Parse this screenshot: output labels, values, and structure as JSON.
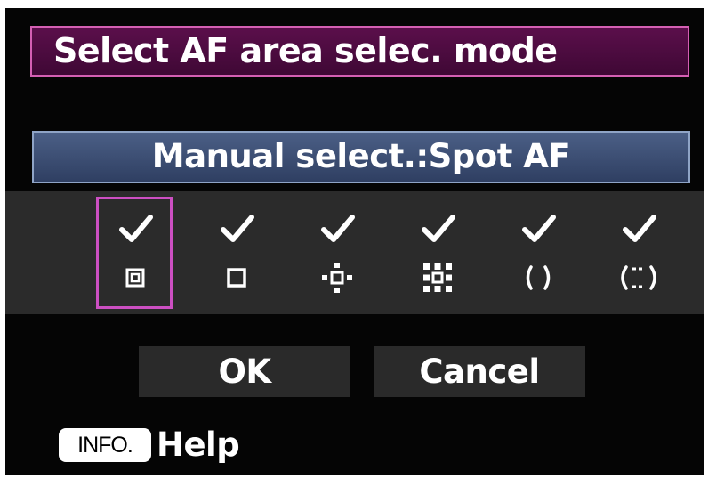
{
  "header": {
    "title": "Select AF area selec. mode"
  },
  "mode_label": "Manual select.:Spot AF",
  "af_options": [
    {
      "icon": "spot-af-icon",
      "checked": true,
      "selected": true
    },
    {
      "icon": "single-point-af-icon",
      "checked": true,
      "selected": false
    },
    {
      "icon": "af-point-expansion-icon",
      "checked": true,
      "selected": false
    },
    {
      "icon": "af-point-expansion-surround-icon",
      "checked": true,
      "selected": false
    },
    {
      "icon": "zone-af-icon",
      "checked": true,
      "selected": false
    },
    {
      "icon": "auto-af-selection-icon",
      "checked": true,
      "selected": false
    }
  ],
  "buttons": {
    "ok_label": "OK",
    "cancel_label": "Cancel"
  },
  "footer": {
    "info_key_label": "INFO.",
    "help_label": "Help"
  },
  "colors": {
    "title_bg": "#4d0c41",
    "title_border": "#d45fb3",
    "mode_bg": "#3d4e72",
    "selection_border": "#cc4fc2",
    "band_bg": "#2b2b2b",
    "button_bg": "#2a2a2a"
  }
}
